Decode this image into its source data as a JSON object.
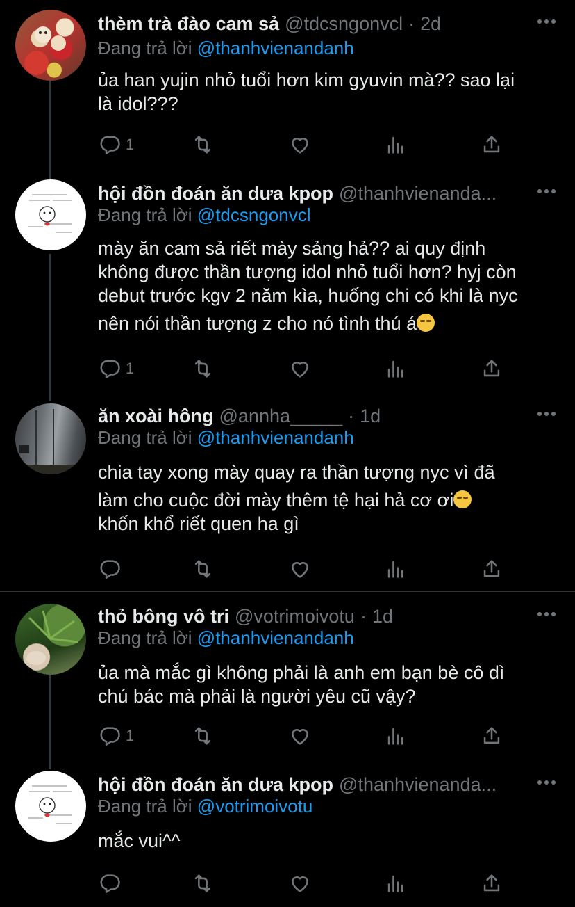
{
  "reply_prefix": "Đang trả lời",
  "tweets": [
    {
      "name": "thèm trà đào cam sả",
      "handle": "@tdcsngonvcl",
      "dot": "·",
      "time": "2d",
      "reply_to": "@thanhvienandanh",
      "lines": [
        "ủa han yujin nhỏ tuổi hơn kim gyuvin mà?? sao lại",
        "là idol???"
      ],
      "reply_count": "1",
      "avatar_icon": "plush-toys-avatar"
    },
    {
      "name": "hội đồn đoán ăn dưa kpop",
      "handle": "@thanhvienanda...",
      "reply_to": "@tdcsngonvcl",
      "lines": [
        "mày ăn cam sả riết mày sảng hả?? ai quy định",
        "không được thần tượng idol nhỏ tuổi hơn? hyj còn",
        "debut trước kgv 2 năm kìa, huống chi có khi là nyc",
        "nên nói thần tượng z cho nó tình thú á"
      ],
      "emoji": "smirk-emoji",
      "reply_count": "1",
      "avatar_icon": "doodle-avatar"
    },
    {
      "name": "ăn xoài hông",
      "handle": "@annha_____",
      "dot": "·",
      "time": "1d",
      "reply_to": "@thanhvienandanh",
      "lines": [
        "chia tay xong mày quay ra thần tượng nyc vì đã",
        "làm cho cuộc đời mày thêm tệ hại hả cơ ơi",
        "khốn khổ riết quen ha gì"
      ],
      "emoji": "relieved-emoji",
      "reply_count": "",
      "avatar_icon": "dark-photo-avatar"
    },
    {
      "name": "thỏ bông vô tri",
      "handle": "@votrimoivotu",
      "dot": "·",
      "time": "1d",
      "reply_to": "@thanhvienandanh",
      "lines": [
        "ủa mà mắc gì không phải là anh em bạn bè cô dì",
        "chú bác mà phải là người yêu cũ vậy?"
      ],
      "reply_count": "1",
      "avatar_icon": "plant-photo-avatar"
    },
    {
      "name": "hội đồn đoán ăn dưa kpop",
      "handle": "@thanhvienanda...",
      "reply_to": "@votrimoivotu",
      "lines": [
        "mắc vui^^"
      ],
      "reply_count": "",
      "avatar_icon": "doodle-avatar"
    }
  ],
  "colors": {
    "background": "#000000",
    "text": "#e7e9ea",
    "muted": "#71767b",
    "accent": "#1d9bf0",
    "line": "#333639"
  }
}
